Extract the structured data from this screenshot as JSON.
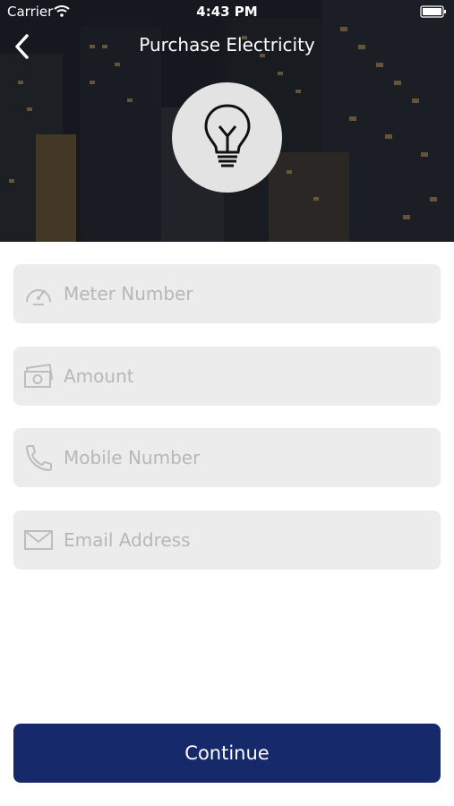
{
  "status_bar": {
    "carrier": "Carrier",
    "time": "4:43 PM"
  },
  "header": {
    "title": "Purchase Electricity",
    "back_icon": "chevron-left-icon",
    "hero_icon": "lightbulb-icon"
  },
  "form": {
    "fields": [
      {
        "icon": "speedometer-icon",
        "value": "",
        "placeholder": "Meter Number"
      },
      {
        "icon": "cash-icon",
        "value": "",
        "placeholder": "Amount"
      },
      {
        "icon": "phone-icon",
        "value": "",
        "placeholder": "Mobile Number"
      },
      {
        "icon": "envelope-icon",
        "value": "",
        "placeholder": "Email Address"
      }
    ]
  },
  "footer": {
    "continue_label": "Continue"
  },
  "colors": {
    "primary_button": "#15296b",
    "field_background": "#ececec",
    "placeholder_text": "#b7b7b7"
  }
}
